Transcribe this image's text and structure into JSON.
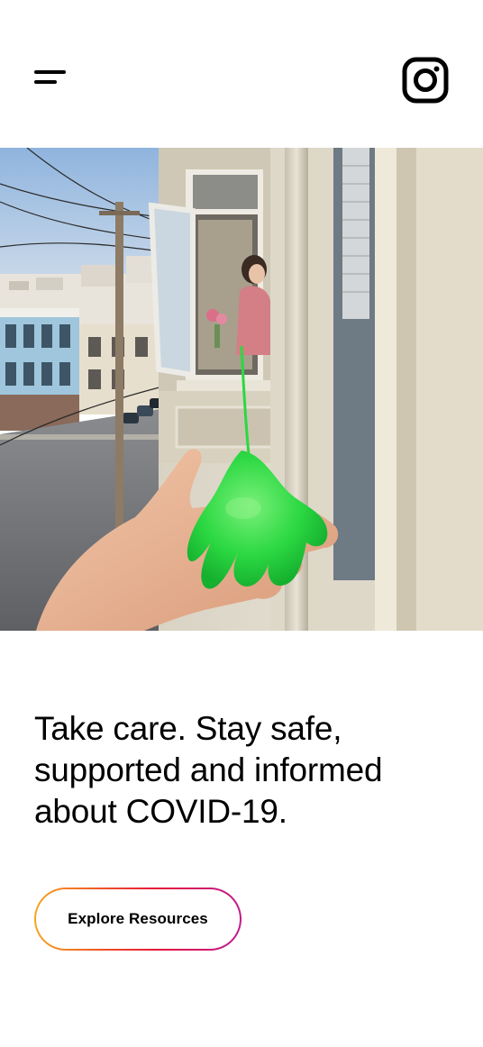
{
  "header": {
    "menu_icon": "hamburger-menu-icon",
    "instagram_icon": "instagram-logo-icon"
  },
  "hero": {
    "image_subject": "slime-hand-toy-window-street-photo"
  },
  "headline": {
    "text": "Take care. Stay safe, supported and informed about COVID-19."
  },
  "cta": {
    "label": "Explore Resources",
    "gradient_colors": [
      "#f5a623",
      "#f05a24",
      "#e4163c",
      "#c21a8f"
    ]
  }
}
